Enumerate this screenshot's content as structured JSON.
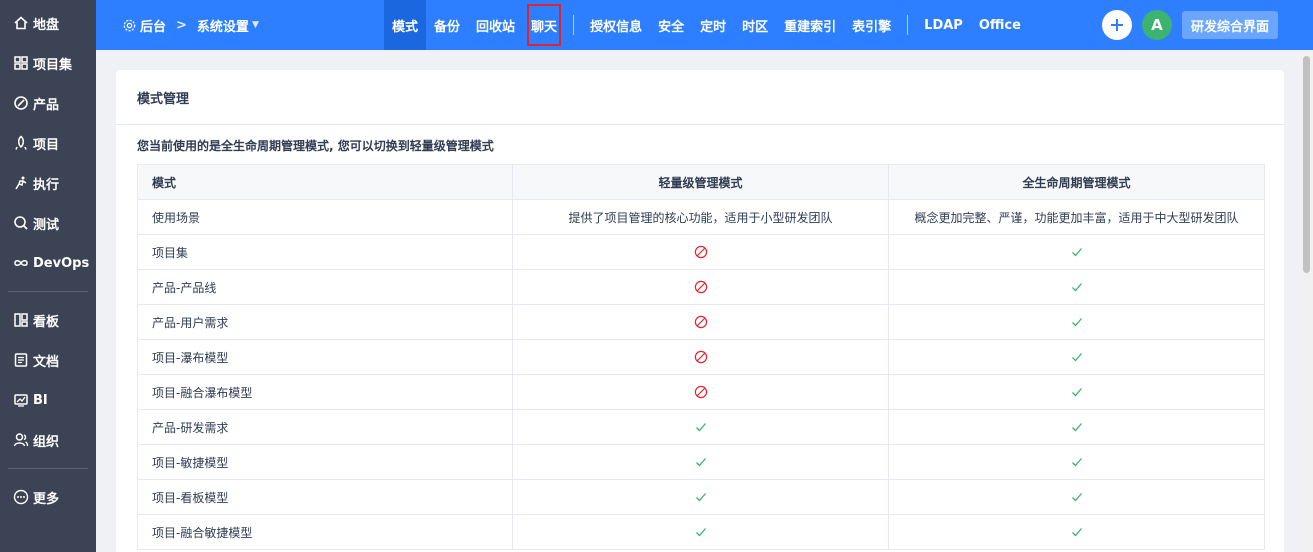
{
  "sidebar": {
    "items": [
      {
        "label": "地盘",
        "icon": "home-icon"
      },
      {
        "label": "项目集",
        "icon": "grid-icon"
      },
      {
        "label": "产品",
        "icon": "product-icon"
      },
      {
        "label": "项目",
        "icon": "project-icon"
      },
      {
        "label": "执行",
        "icon": "run-icon"
      },
      {
        "label": "测试",
        "icon": "test-icon"
      },
      {
        "label": "DevOps",
        "icon": "infinity-icon"
      },
      {
        "label": "看板",
        "icon": "kanban-icon"
      },
      {
        "label": "文档",
        "icon": "doc-icon"
      },
      {
        "label": "BI",
        "icon": "bi-icon"
      },
      {
        "label": "组织",
        "icon": "people-icon"
      },
      {
        "label": "更多",
        "icon": "more-icon"
      }
    ]
  },
  "header": {
    "breadcrumb": {
      "root": "后台",
      "separator": ">",
      "current": "系统设置"
    },
    "tabs": [
      {
        "label": "模式"
      },
      {
        "label": "备份"
      },
      {
        "label": "回收站"
      },
      {
        "label": "聊天"
      },
      {
        "label": "授权信息"
      },
      {
        "label": "安全"
      },
      {
        "label": "定时"
      },
      {
        "label": "时区"
      },
      {
        "label": "重建索引"
      },
      {
        "label": "表引擎"
      },
      {
        "label": "LDAP"
      },
      {
        "label": "Office"
      }
    ],
    "avatar_letter": "A",
    "project_button": "研发综合界面"
  },
  "panel": {
    "title": "模式管理",
    "intro": "您当前使用的是全生命周期管理模式, 您可以切换到轻量级管理模式",
    "table": {
      "headers": [
        "模式",
        "轻量级管理模式",
        "全生命周期管理模式"
      ],
      "scenario_row": {
        "label": "使用场景",
        "lite": "提供了项目管理的核心功能，适用于小型研发团队",
        "full": "概念更加完整、严谨，功能更加丰富，适用于中大型研发团队"
      },
      "rows": [
        {
          "label": "项目集",
          "lite": "disabled",
          "full": "check"
        },
        {
          "label": "产品-产品线",
          "lite": "disabled",
          "full": "check"
        },
        {
          "label": "产品-用户需求",
          "lite": "disabled",
          "full": "check"
        },
        {
          "label": "项目-瀑布模型",
          "lite": "disabled",
          "full": "check"
        },
        {
          "label": "项目-融合瀑布模型",
          "lite": "disabled",
          "full": "check"
        },
        {
          "label": "产品-研发需求",
          "lite": "check",
          "full": "check"
        },
        {
          "label": "项目-敏捷模型",
          "lite": "check",
          "full": "check"
        },
        {
          "label": "项目-看板模型",
          "lite": "check",
          "full": "check"
        },
        {
          "label": "项目-融合敏捷模型",
          "lite": "check",
          "full": "check"
        }
      ]
    }
  },
  "colors": {
    "header_bg": "#2e7fff",
    "active_tab": "#1a67e0",
    "sidebar_bg": "#3c4354",
    "check": "#3cb371",
    "disabled": "#e0262c",
    "highlight_box": "#e0262c"
  }
}
